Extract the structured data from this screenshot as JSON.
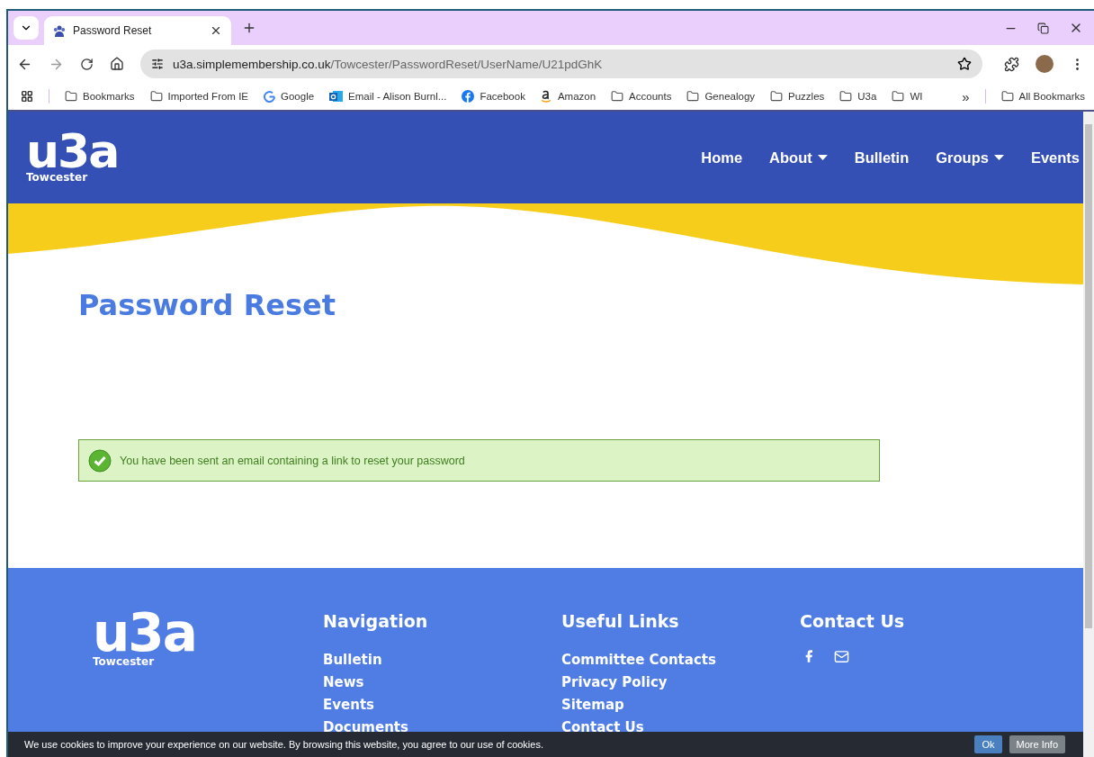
{
  "browser": {
    "tabs": [
      {
        "title": "Password Reset",
        "selected": true
      }
    ],
    "address": {
      "host": "u3a.simplemembership.co.uk",
      "path": "/Towcester/PasswordReset/UserName/U21pdGhK"
    },
    "bookmarks": [
      {
        "kind": "folder",
        "label": "Bookmarks"
      },
      {
        "kind": "folder",
        "label": "Imported From IE"
      },
      {
        "kind": "google",
        "label": "Google"
      },
      {
        "kind": "outlook",
        "label": "Email - Alison Burnl..."
      },
      {
        "kind": "facebook",
        "label": "Facebook"
      },
      {
        "kind": "amazon",
        "label": "Amazon"
      },
      {
        "kind": "folder",
        "label": "Accounts"
      },
      {
        "kind": "folder",
        "label": "Genealogy"
      },
      {
        "kind": "folder",
        "label": "Puzzles"
      },
      {
        "kind": "folder",
        "label": "U3a"
      },
      {
        "kind": "folder",
        "label": "WI"
      }
    ],
    "more_bookmarks": "»",
    "all_bookmarks": "All Bookmarks"
  },
  "site": {
    "logo": {
      "mark": "u3a",
      "place": "Towcester"
    },
    "nav": [
      {
        "label": "Home",
        "dropdown": false
      },
      {
        "label": "About",
        "dropdown": true
      },
      {
        "label": "Bulletin",
        "dropdown": false
      },
      {
        "label": "Groups",
        "dropdown": true
      },
      {
        "label": "Events",
        "dropdown": false
      }
    ],
    "title": "Password Reset",
    "alert": {
      "message": "You have been sent an email containing a link to reset your password"
    },
    "footer": {
      "logo": {
        "mark": "u3a",
        "place": "Towcester"
      },
      "columns": [
        {
          "heading": "Navigation",
          "links": [
            "Bulletin",
            "News",
            "Events",
            "Documents"
          ]
        },
        {
          "heading": "Useful Links",
          "links": [
            "Committee Contacts",
            "Privacy Policy",
            "Sitemap",
            "Contact Us"
          ]
        },
        {
          "heading": "Contact Us"
        }
      ]
    },
    "cookie_bar": {
      "text": "We use cookies to improve your experience on our website. By browsing this website, you agree to our use of cookies.",
      "buttons": [
        "Ok",
        "More Info"
      ]
    }
  }
}
